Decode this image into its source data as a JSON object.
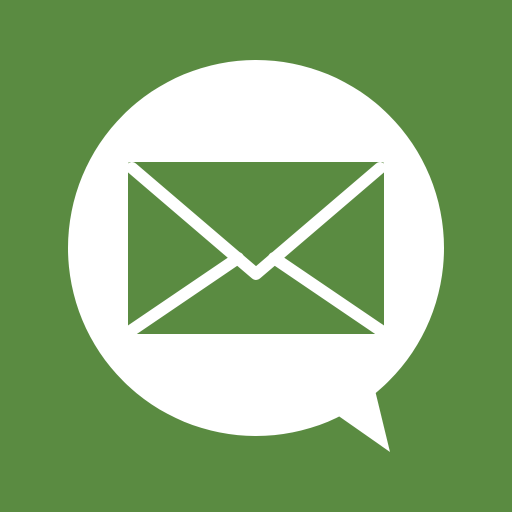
{
  "icon": {
    "name": "chat-mail-icon",
    "background_color": "#5A8B41",
    "foreground_color": "#FFFFFF"
  }
}
